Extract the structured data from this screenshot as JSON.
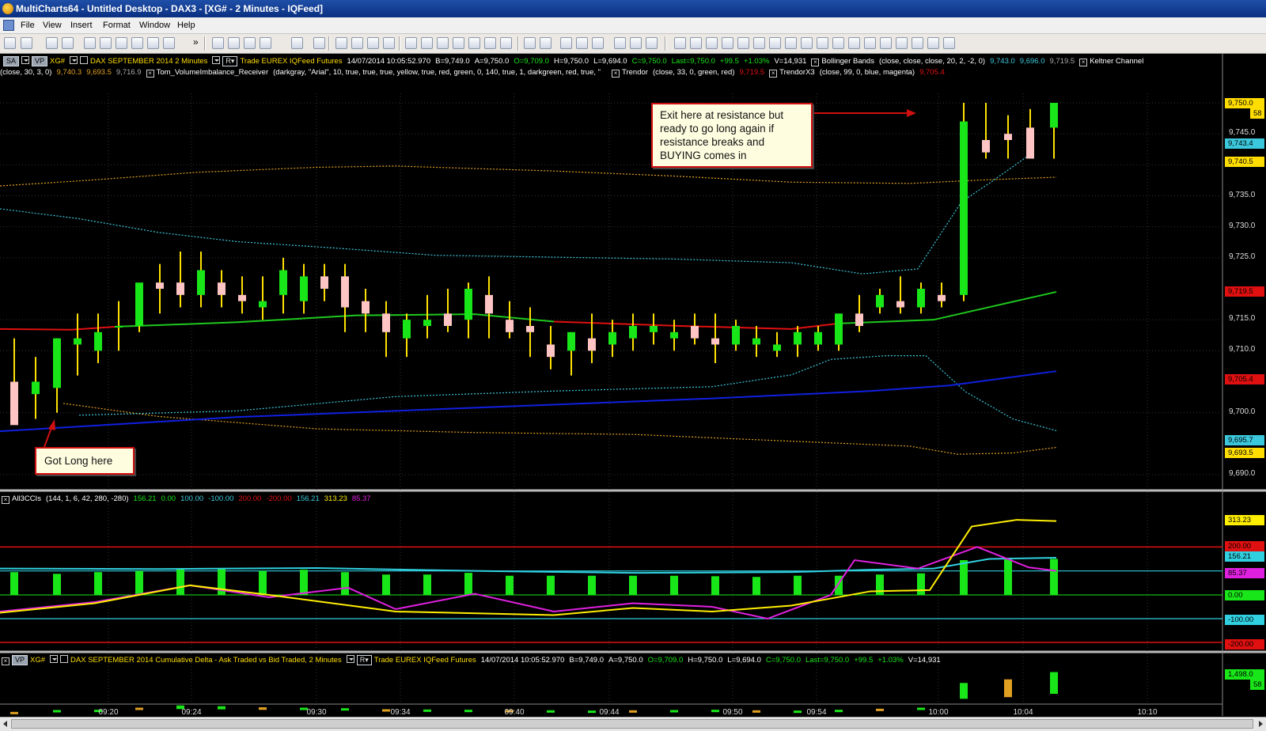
{
  "window": {
    "title": "MultiCharts64 - Untitled Desktop - DAX3 - [XG# - 2 Minutes - IQFeed]"
  },
  "menu": [
    "File",
    "View",
    "Insert",
    "Format",
    "Window",
    "Help"
  ],
  "toolbar": {
    "overflow_glyph": "»"
  },
  "price_pane": {
    "line1": {
      "chip_sa": "SA",
      "chip_vp": "VP",
      "symbol": "XG#",
      "description": "DAX SEPTEMBER 2014  2 Minutes",
      "datafeed": "Trade  EUREX  IQFeed  Futures",
      "timestamp": "14/07/2014  10:05:52.970",
      "bid": "B=9,749.0",
      "ask": "A=9,750.0",
      "open": "O=9,709.0",
      "high": "H=9,750.0",
      "low": "L=9,694.0",
      "close": "C=9,750.0",
      "last": "Last=9,750.0",
      "change": "+99.5",
      "change_pct": "+1.03%",
      "volume": "V=14,931",
      "bb_name": "Bollinger Bands",
      "bb_params": "(close, close, close, 20, 2, -2, 0)",
      "bb_v1": "9,743.0",
      "bb_v2": "9,696.0",
      "bb_v3": "9,719.5",
      "kc_name": "Keltner Channel"
    },
    "line2": {
      "kc_params": "(close, 30, 3, 0)",
      "kc_v1": "9,740.3",
      "kc_v2": "9,693.5",
      "kc_v3": "9,716.9",
      "vi_name": "Tom_VolumeImbalance_Receiver",
      "vi_params": "(darkgray, \"Arial\", 10, true, true, true, yellow, true, red, green, 0, 140, true, 1, darkgreen, red, true, \"",
      "tr_name": "Trendor",
      "tr_params": "(close, 33, 0, green, red)",
      "tr_v": "9,719.5",
      "tr3_name": "TrendorX3",
      "tr3_params": "(close, 99, 0, blue, magenta)",
      "tr3_v": "9,705.4"
    },
    "y_axis": [
      {
        "v": 9750,
        "label": "9,750.0"
      },
      {
        "v": 9745,
        "label": "9,745.0"
      },
      {
        "v": 9740,
        "label": "9,740.5"
      },
      {
        "v": 9735,
        "label": "9,735.0"
      },
      {
        "v": 9730,
        "label": "9,730.0"
      },
      {
        "v": 9725,
        "label": "9,725.0"
      },
      {
        "v": 9715,
        "label": "9,715.0"
      },
      {
        "v": 9710,
        "label": "9,710.0"
      },
      {
        "v": 9700,
        "label": "9,700.0"
      },
      {
        "v": 9690,
        "label": "9,690.0"
      }
    ],
    "price_tags": {
      "last": "9,750.0",
      "last_sub": "58",
      "bb_upper": "9,743.4",
      "kc_upper": "9,740.5",
      "trendor": "9,719.5",
      "trendorx3": "9,705.4",
      "bb_lower": "9,695.7",
      "kc_lower": "9,693.5"
    },
    "callouts": {
      "exit": [
        "Exit here at resistance but",
        "ready to go long again if",
        "resistance breaks and",
        "BUYING comes in"
      ],
      "long": "Got Long here"
    }
  },
  "cci_pane": {
    "name": "All3CCIs",
    "params": "(144, 1, 6, 42, 280, -280)",
    "v1": "156.21",
    "v2": "0.00",
    "v3": "100.00",
    "v4": "-100.00",
    "v5": "200.00",
    "v6": "-200.00",
    "v7": "156.21",
    "v8": "313.23",
    "v9": "85.37",
    "axis_tags": {
      "t1": "313.23",
      "t2": "200.00",
      "t3": "156.21",
      "t4": "85.37",
      "t5": "0.00",
      "t6": "-100.00",
      "t7": "-200.00"
    }
  },
  "delta_pane": {
    "chip_vp": "VP",
    "symbol": "XG#",
    "description": "DAX SEPTEMBER 2014  Cumulative Delta - Ask Traded vs Bid Traded, 2 Minutes",
    "datafeed": "Trade  EUREX  IQFeed  Futures",
    "timestamp": "14/07/2014  10:05:52.970",
    "bid": "B=9,749.0",
    "ask": "A=9,750.0",
    "open": "O=9,709.0",
    "high": "H=9,750.0",
    "low": "L=9,694.0",
    "close": "C=9,750.0",
    "last": "Last=9,750.0",
    "change": "+99.5",
    "change_pct": "+1.03%",
    "volume": "V=14,931",
    "axis_tag": "1,498.0",
    "axis_tag_sub": "58"
  },
  "time_axis": [
    "09:20",
    "09:24",
    "09:30",
    "09:34",
    "09:40",
    "09:44",
    "09:50",
    "09:54",
    "10:00",
    "10:04",
    "10:10"
  ],
  "colors": {
    "up": "#19e619",
    "down": "#ffc4c4",
    "wick": "#ffe100",
    "trendor_up": "#1ec81e",
    "trendor_down": "#e01010",
    "trendorx3": "#1020e0",
    "bb": "#3cc8dc",
    "kc": "#e0a020",
    "cci_yellow": "#ffee00",
    "cci_magenta": "#e020e0",
    "cci_cyan": "#30d0e0"
  }
}
